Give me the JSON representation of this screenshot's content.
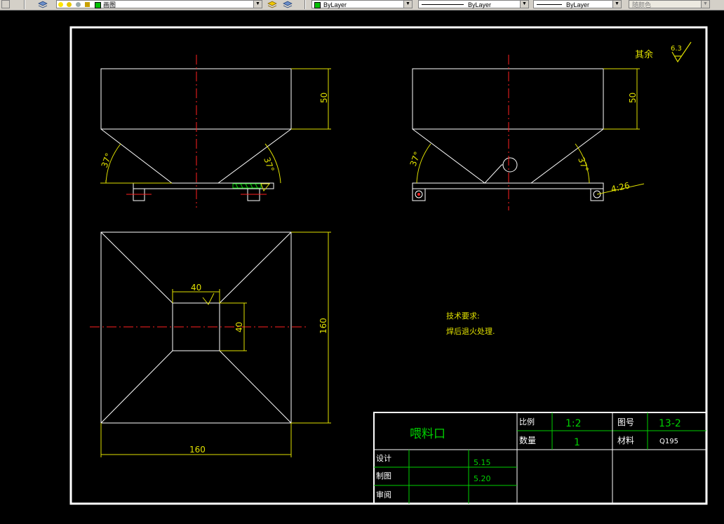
{
  "toolbar": {
    "layer_name": "画图",
    "color_label": "ByLayer",
    "linetype_label": "ByLayer",
    "lineweight_label": "ByLayer",
    "plotstyle_label": "随颜色",
    "colors": {
      "layer_swatch": "#00c000",
      "color_swatch": "#00c000"
    }
  },
  "drawing": {
    "roughness_note": "其余",
    "roughness_value": "6.3",
    "front": {
      "height_dim": "50",
      "angle_left": "37°",
      "angle_right": "37°"
    },
    "side": {
      "height_dim": "50",
      "angle_left": "37°",
      "angle_right": "37°",
      "hole_dim": "4:26"
    },
    "top": {
      "inner_width_dim": "40",
      "inner_height_dim": "40",
      "outer_height_dim": "160",
      "outer_width_dim": "160"
    },
    "tech_title": "技术要求:",
    "tech_note": "焊后退火处理.",
    "title_block": {
      "part_name": "喂料口",
      "scale_label": "比例",
      "scale_value": "1:2",
      "drawing_no_label": "图号",
      "drawing_no_value": "13-2",
      "qty_label": "数量",
      "qty_value": "1",
      "material_label": "材料",
      "material_value": "Q195",
      "design_label": "设计",
      "design_date": "5.15",
      "draw_label": "制图",
      "draw_date": "5.20",
      "review_label": "审阅"
    }
  }
}
